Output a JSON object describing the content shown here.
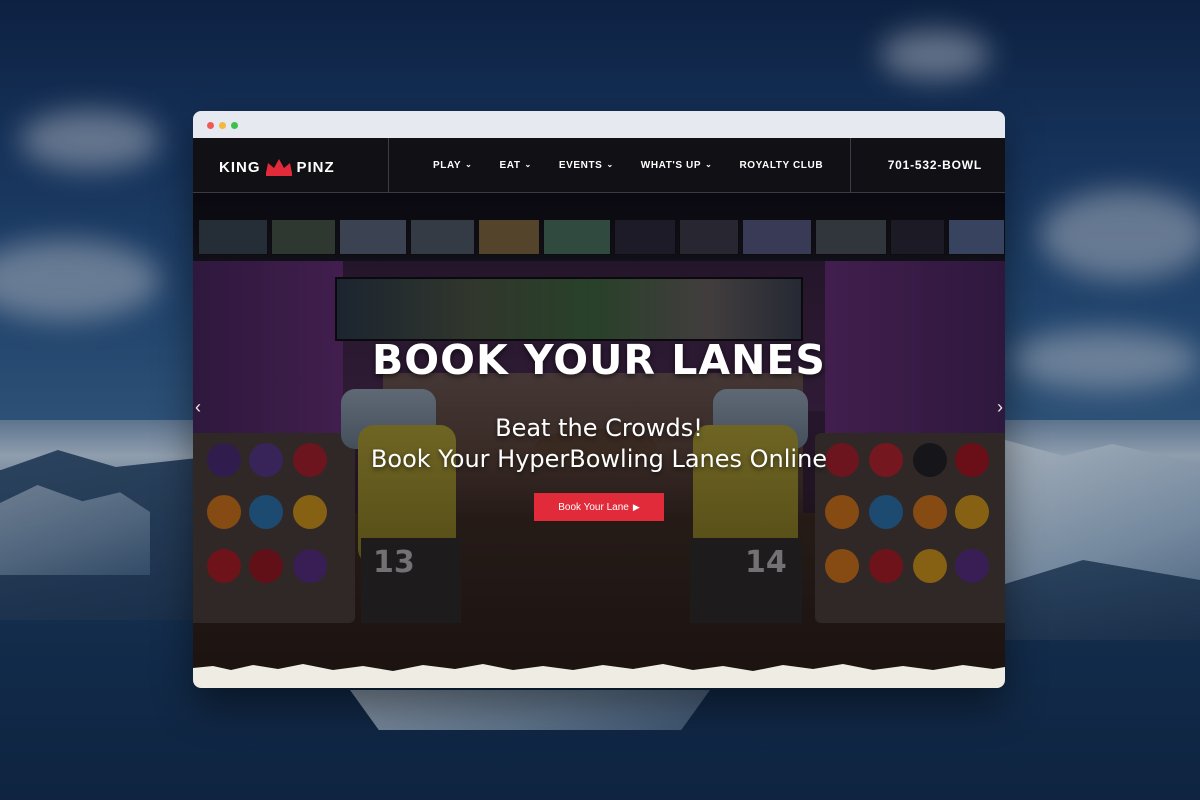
{
  "site": {
    "logo_text_left": "KING",
    "logo_text_right": "PINZ",
    "nav": [
      {
        "label": "PLAY",
        "has_dropdown": true
      },
      {
        "label": "EAT",
        "has_dropdown": true
      },
      {
        "label": "EVENTS",
        "has_dropdown": true
      },
      {
        "label": "WHAT'S UP",
        "has_dropdown": true
      },
      {
        "label": "ROYALTY CLUB",
        "has_dropdown": false
      }
    ],
    "phone": "701-532-BOWL"
  },
  "hero": {
    "title": "BOOK YOUR LANES",
    "subtitle_line1": "Beat the Crowds!",
    "subtitle_line2": "Book Your HyperBowling Lanes Online",
    "button_label": "Book Your Lane",
    "lane_number_left": "13",
    "lane_number_right": "14",
    "prev_arrow": "‹",
    "next_arrow": "›"
  },
  "icons": {
    "crown": "crown-icon",
    "chevron": "chevron-down-icon",
    "play": "play-circle-icon",
    "prev": "chevron-left-icon",
    "next": "chevron-right-icon"
  },
  "colors": {
    "accent_red": "#e12b3a",
    "header_bg": "#101015",
    "text_white": "#ffffff",
    "torn_paper": "#efece3"
  }
}
